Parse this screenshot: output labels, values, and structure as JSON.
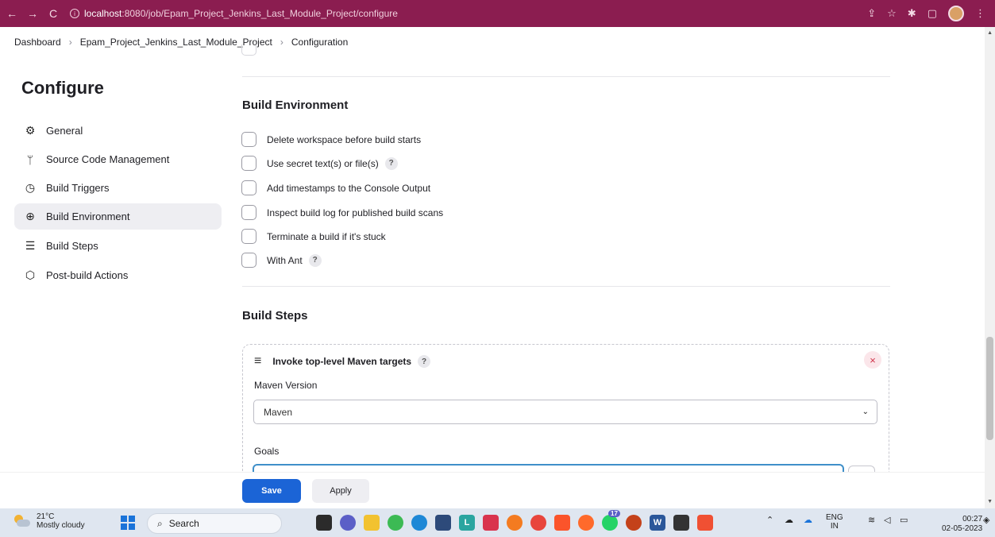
{
  "browser": {
    "url_host": "localhost",
    "url_path": ":8080/job/Epam_Project_Jenkins_Last_Module_Project/configure"
  },
  "breadcrumb": {
    "items": [
      "Dashboard",
      "Epam_Project_Jenkins_Last_Module_Project",
      "Configuration"
    ]
  },
  "sidebar": {
    "title": "Configure",
    "items": [
      {
        "label": "General",
        "icon": "gear-icon"
      },
      {
        "label": "Source Code Management",
        "icon": "branch-icon"
      },
      {
        "label": "Build Triggers",
        "icon": "clock-icon"
      },
      {
        "label": "Build Environment",
        "icon": "globe-icon"
      },
      {
        "label": "Build Steps",
        "icon": "list-icon"
      },
      {
        "label": "Post-build Actions",
        "icon": "cube-icon"
      }
    ],
    "active_index": 3
  },
  "build_environment": {
    "title": "Build Environment",
    "options": [
      {
        "label": "Delete workspace before build starts",
        "help": false
      },
      {
        "label": "Use secret text(s) or file(s)",
        "help": true
      },
      {
        "label": "Add timestamps to the Console Output",
        "help": false
      },
      {
        "label": "Inspect build log for published build scans",
        "help": false
      },
      {
        "label": "Terminate a build if it's stuck",
        "help": false
      },
      {
        "label": "With Ant",
        "help": true
      }
    ]
  },
  "build_steps": {
    "title": "Build Steps",
    "step": {
      "title": "Invoke top-level Maven targets",
      "maven_version_label": "Maven Version",
      "maven_version_value": "Maven",
      "goals_label": "Goals"
    }
  },
  "actions": {
    "save": "Save",
    "apply": "Apply"
  },
  "taskbar": {
    "temperature": "21°C",
    "weather": "Mostly cloudy",
    "search_placeholder": "Search",
    "lang_top": "ENG",
    "lang_bottom": "IN",
    "time": "00:27",
    "date": "02-05-2023",
    "notification_badge": "17"
  },
  "help_glyph": "?",
  "close_glyph": "×"
}
